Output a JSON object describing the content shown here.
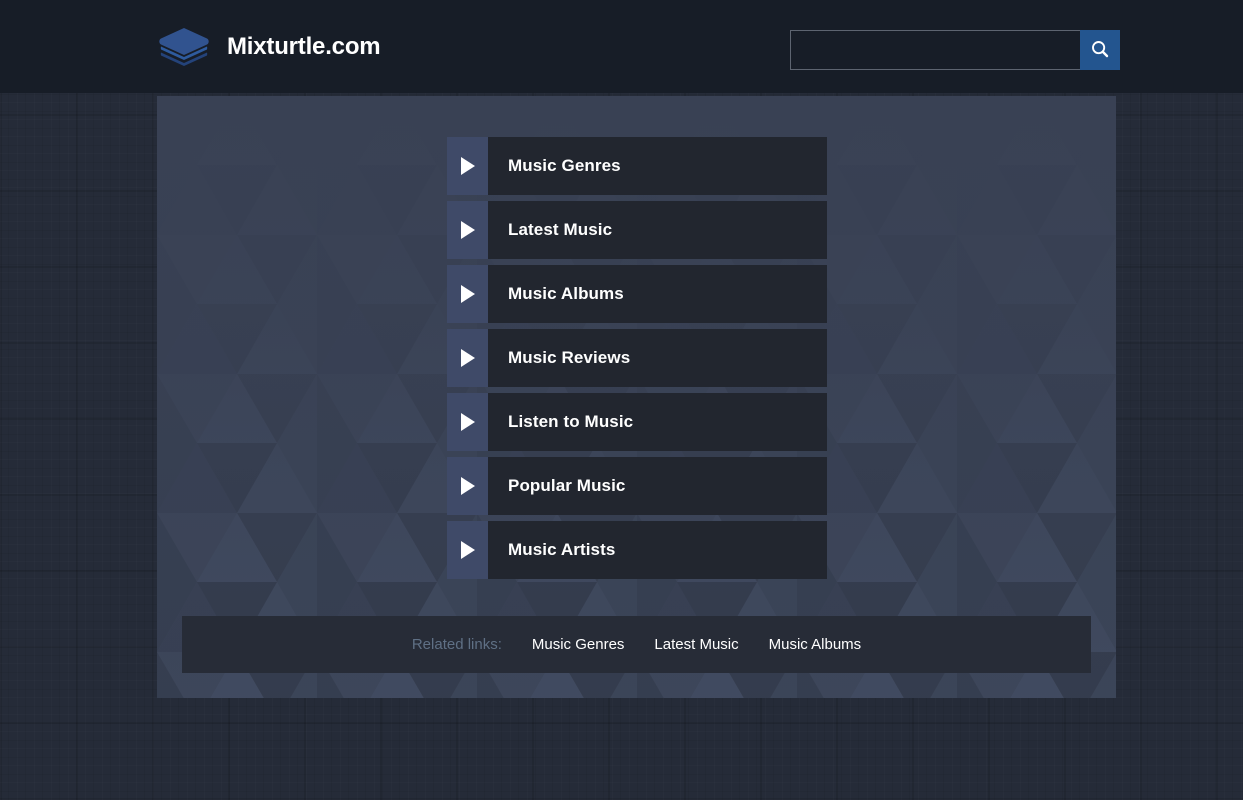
{
  "header": {
    "brand_title": "Mixturtle.com",
    "logo_icon": "stacked-layers-icon",
    "search": {
      "value": "",
      "placeholder": "",
      "button_icon": "search-icon"
    }
  },
  "main": {
    "menu_items": [
      {
        "label": "Music Genres",
        "icon": "play-triangle-icon"
      },
      {
        "label": "Latest Music",
        "icon": "play-triangle-icon"
      },
      {
        "label": "Music Albums",
        "icon": "play-triangle-icon"
      },
      {
        "label": "Music Reviews",
        "icon": "play-triangle-icon"
      },
      {
        "label": "Listen to Music",
        "icon": "play-triangle-icon"
      },
      {
        "label": "Popular Music",
        "icon": "play-triangle-icon"
      },
      {
        "label": "Music Artists",
        "icon": "play-triangle-icon"
      }
    ]
  },
  "footer": {
    "related_label": "Related links:",
    "related_links": [
      "Music Genres",
      "Latest Music",
      "Music Albums"
    ]
  },
  "colors": {
    "header_bg": "#171d27",
    "page_bg": "#252b38",
    "container_bg": "#394154",
    "menu_accent": "#3f4a68",
    "menu_item_bg": "#22262f",
    "search_button": "#23558f",
    "footer_bg": "#272c37",
    "muted_text": "#5f7085",
    "text": "#ffffff"
  }
}
